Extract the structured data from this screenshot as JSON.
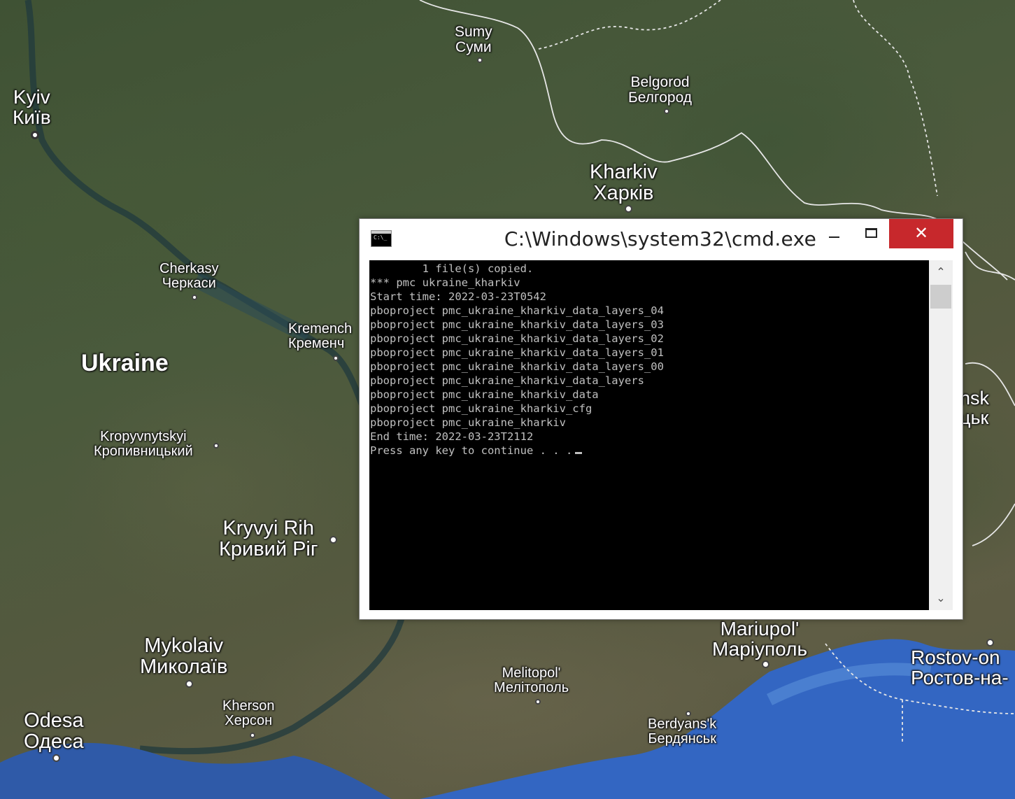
{
  "map": {
    "places": [
      {
        "id": "kyiv",
        "latin": "Kyiv",
        "cyrillic": "Київ"
      },
      {
        "id": "sumy",
        "latin": "Sumy",
        "cyrillic": "Суми"
      },
      {
        "id": "belgorod",
        "latin": "Belgorod",
        "cyrillic": "Белгород"
      },
      {
        "id": "kharkiv",
        "latin": "Kharkiv",
        "cyrillic": "Харків"
      },
      {
        "id": "cherkasy",
        "latin": "Cherkasy",
        "cyrillic": "Черкаси"
      },
      {
        "id": "kremenchuk",
        "latin": "Kremench",
        "cyrillic": "Кременч"
      },
      {
        "id": "ukraine",
        "latin": "Ukraine",
        "cyrillic": ""
      },
      {
        "id": "kropyvnytskyi",
        "latin": "Kropyvnytskyi",
        "cyrillic": "Кропивницький"
      },
      {
        "id": "kryvyi-rih",
        "latin": "Kryvyi Rih",
        "cyrillic": "Кривий Ріг"
      },
      {
        "id": "mykolaiv",
        "latin": "Mykolaiv",
        "cyrillic": "Миколаїв"
      },
      {
        "id": "odesa",
        "latin": "Odesa",
        "cyrillic": "Одеса"
      },
      {
        "id": "kherson",
        "latin": "Kherson",
        "cyrillic": "Херсон"
      },
      {
        "id": "melitopol",
        "latin": "Melitopol'",
        "cyrillic": "Мелітополь"
      },
      {
        "id": "berdyansk",
        "latin": "Berdyans'k",
        "cyrillic": "Бердянськ"
      },
      {
        "id": "mariupol",
        "latin": "Mariupol'",
        "cyrillic": "Маріуполь"
      },
      {
        "id": "rostov",
        "latin": "Rostov-on",
        "cyrillic": "Ростов-на-"
      },
      {
        "id": "donetsk-partial",
        "latin": "nsk",
        "cyrillic": "цьк"
      }
    ]
  },
  "window": {
    "title": "C:\\Windows\\system32\\cmd.exe",
    "icon_label": "C:\\_",
    "close_glyph": "✕",
    "scroll_up_glyph": "⌃",
    "scroll_down_glyph": "⌄"
  },
  "console": {
    "lines": [
      "        1 file(s) copied.",
      "*** pmc ukraine_kharkiv",
      "Start time: 2022-03-23T0542",
      "pboproject pmc_ukraine_kharkiv_data_layers_04",
      "pboproject pmc_ukraine_kharkiv_data_layers_03",
      "pboproject pmc_ukraine_kharkiv_data_layers_02",
      "pboproject pmc_ukraine_kharkiv_data_layers_01",
      "pboproject pmc_ukraine_kharkiv_data_layers_00",
      "pboproject pmc_ukraine_kharkiv_data_layers",
      "pboproject pmc_ukraine_kharkiv_data",
      "pboproject pmc_ukraine_kharkiv_cfg",
      "pboproject pmc_ukraine_kharkiv",
      "End time: 2022-03-23T2112",
      "Press any key to continue . . ."
    ]
  },
  "colors": {
    "close_button": "#c7282c",
    "console_bg": "#000000",
    "console_text": "#c0c0c0",
    "sea": "#2f5aa8"
  }
}
